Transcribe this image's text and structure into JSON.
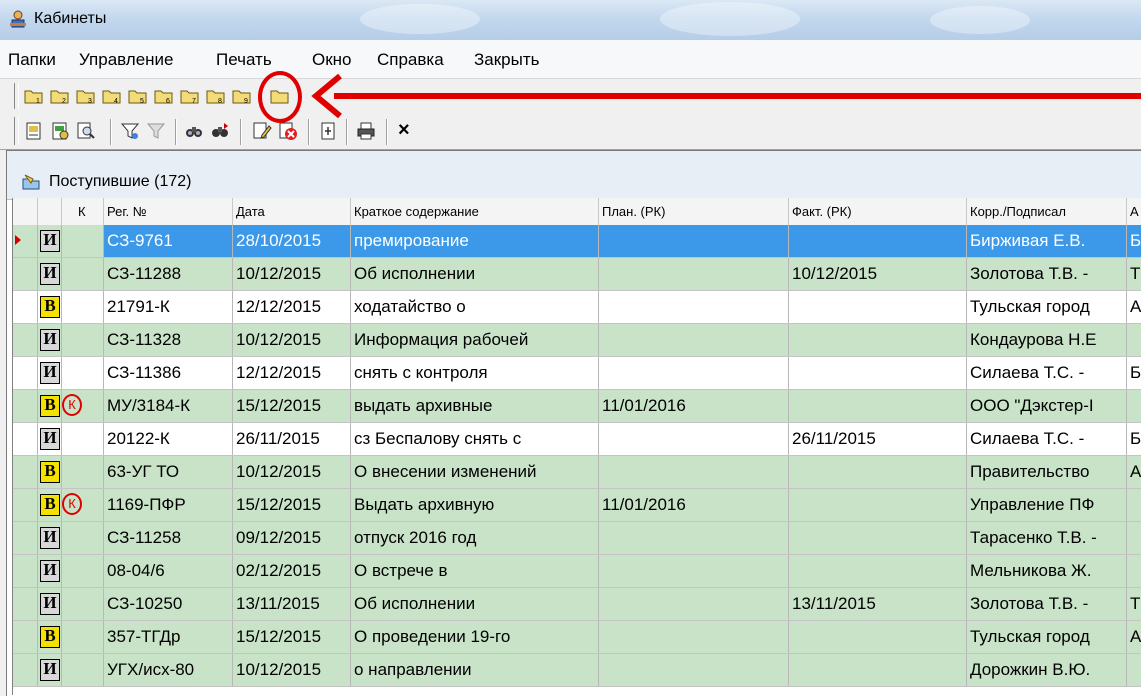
{
  "window": {
    "title": "Кабинеты"
  },
  "menu": [
    "Папки",
    "Управление",
    "Печать",
    "Окно",
    "Справка",
    "Закрыть"
  ],
  "folders": [
    "1",
    "2",
    "3",
    "4",
    "5",
    "6",
    "7",
    "8",
    "9"
  ],
  "toolbar2_icons": [
    "open-card-icon",
    "new-card-icon",
    "search-card-icon",
    "filter-icon",
    "filter-off-icon",
    "find-icon",
    "find-next-icon",
    "edit-icon",
    "delete-icon",
    "export-icon",
    "print-icon",
    "close-icon"
  ],
  "toolbar": {
    "close_label": "×"
  },
  "list": {
    "title": "Поступившие (172)"
  },
  "columns": [
    "",
    "К",
    "Рег. №",
    "Дата",
    "Краткое содержание",
    "План. (РК)",
    "Факт. (РК)",
    "Корр./Подписал",
    "А"
  ],
  "rows": [
    {
      "badge": "И",
      "control": "",
      "reg": "СЗ-9761",
      "date": "28/10/2015",
      "summary": "премирование",
      "plan": "",
      "fact": "",
      "corr": "Бирживая Е.В.",
      "a": "Б",
      "bg": "sel"
    },
    {
      "badge": "И",
      "control": "",
      "reg": "СЗ-11288",
      "date": "10/12/2015",
      "summary": "Об исполнении",
      "plan": "",
      "fact": "10/12/2015",
      "corr": "Золотова Т.В. -",
      "a": "Т",
      "bg": "green"
    },
    {
      "badge": "В",
      "control": "",
      "reg": "21791-К",
      "date": "12/12/2015",
      "summary": "ходатайство о",
      "plan": "",
      "fact": "",
      "corr": "Тульская город",
      "a": "А",
      "bg": "white"
    },
    {
      "badge": "И",
      "control": "",
      "reg": "СЗ-11328",
      "date": "10/12/2015",
      "summary": "Информация рабочей",
      "plan": "",
      "fact": "",
      "corr": "Кондаурова Н.Е",
      "a": "",
      "bg": "green"
    },
    {
      "badge": "И",
      "control": "",
      "reg": "СЗ-11386",
      "date": "12/12/2015",
      "summary": "снять с контроля",
      "plan": "",
      "fact": "",
      "corr": "Силаева Т.С. -",
      "a": "Б",
      "bg": "white"
    },
    {
      "badge": "В",
      "control": "К",
      "reg": "МУ/3184-К",
      "date": "15/12/2015",
      "summary": "выдать архивные",
      "plan": "11/01/2016",
      "fact": "",
      "corr": "ООО \"Дэкстер-I",
      "a": "",
      "bg": "green"
    },
    {
      "badge": "И",
      "control": "",
      "reg": "20122-К",
      "date": "26/11/2015",
      "summary": "сз Беспалову  снять с",
      "plan": "",
      "fact": "26/11/2015",
      "corr": "Силаева Т.С. -",
      "a": "Б",
      "bg": "white"
    },
    {
      "badge": "В",
      "control": "",
      "reg": "63-УГ ТО",
      "date": "10/12/2015",
      "summary": "О внесении изменений",
      "plan": "",
      "fact": "",
      "corr": "Правительство",
      "a": "А",
      "bg": "green"
    },
    {
      "badge": "В",
      "control": "К",
      "reg": "1169-ПФР",
      "date": "15/12/2015",
      "summary": "Выдать архивную",
      "plan": "11/01/2016",
      "fact": "",
      "corr": "Управление ПФ",
      "a": "",
      "bg": "green"
    },
    {
      "badge": "И",
      "control": "",
      "reg": "СЗ-11258",
      "date": "09/12/2015",
      "summary": "отпуск 2016 год",
      "plan": "",
      "fact": "",
      "corr": "Тарасенко Т.В. -",
      "a": "",
      "bg": "green"
    },
    {
      "badge": "И",
      "control": "",
      "reg": "08-04/6",
      "date": "02/12/2015",
      "summary": "О встрече в",
      "plan": "",
      "fact": "",
      "corr": "Мельникова Ж.",
      "a": "",
      "bg": "green"
    },
    {
      "badge": "И",
      "control": "",
      "reg": "СЗ-10250",
      "date": "13/11/2015",
      "summary": "Об исполнении",
      "plan": "",
      "fact": "13/11/2015",
      "corr": "Золотова Т.В. -",
      "a": "Т",
      "bg": "green"
    },
    {
      "badge": "В",
      "control": "",
      "reg": "357-ТГДр",
      "date": "15/12/2015",
      "summary": "О  проведении  19-го",
      "plan": "",
      "fact": "",
      "corr": "Тульская город",
      "a": "А",
      "bg": "green"
    },
    {
      "badge": "И",
      "control": "",
      "reg": "УГХ/исх-80",
      "date": "10/12/2015",
      "summary": "о направлении",
      "plan": "",
      "fact": "",
      "corr": "Дорожкин В.Ю.",
      "a": "",
      "bg": "green"
    }
  ],
  "colors": {
    "selection": "#3c98e8",
    "row_green": "#c8e3c8",
    "annotation": "#e00000"
  }
}
